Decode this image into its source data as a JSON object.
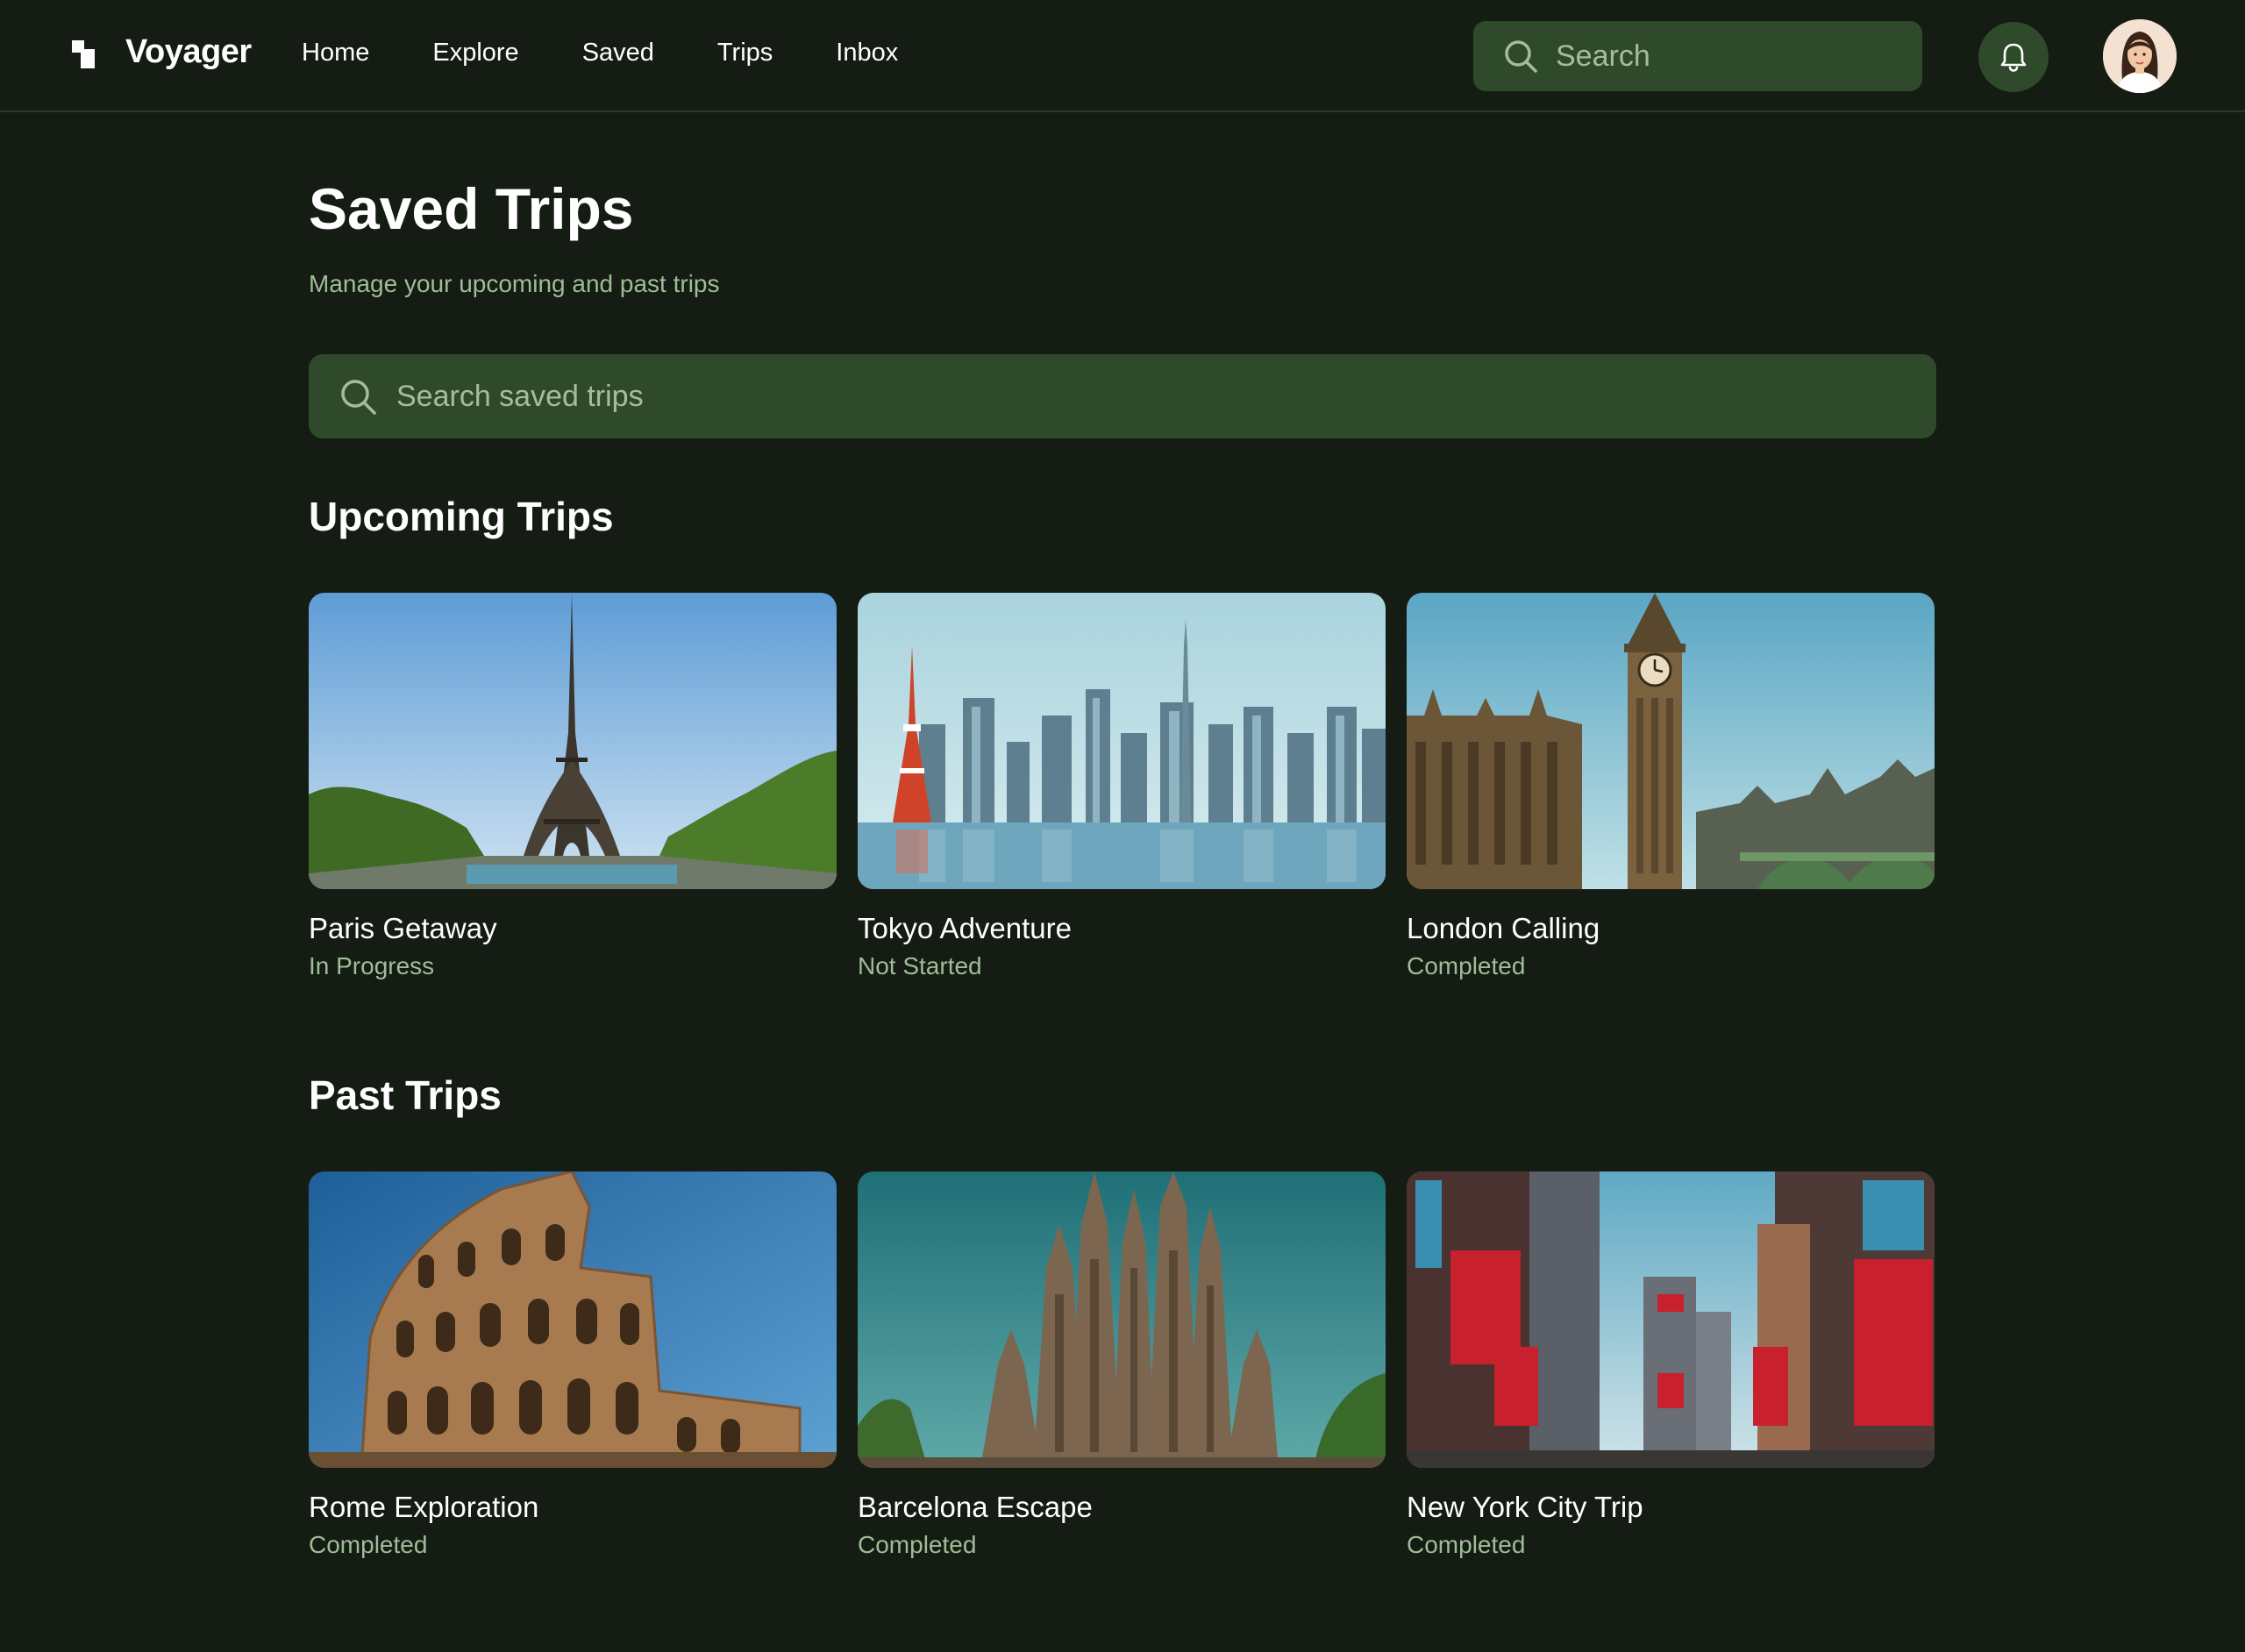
{
  "app": {
    "name": "Voyager"
  },
  "nav": {
    "items": [
      "Home",
      "Explore",
      "Saved",
      "Trips",
      "Inbox"
    ]
  },
  "header": {
    "search_placeholder": "Search"
  },
  "page": {
    "title": "Saved Trips",
    "subtitle": "Manage your upcoming and past trips",
    "search_placeholder": "Search saved trips"
  },
  "sections": [
    {
      "title": "Upcoming Trips",
      "trips": [
        {
          "title": "Paris Getaway",
          "status": "In Progress",
          "image": "eiffel-tower-photo"
        },
        {
          "title": "Tokyo Adventure",
          "status": "Not Started",
          "image": "tokyo-skyline-photo"
        },
        {
          "title": "London Calling",
          "status": "Completed",
          "image": "big-ben-photo"
        }
      ]
    },
    {
      "title": "Past Trips",
      "trips": [
        {
          "title": "Rome Exploration",
          "status": "Completed",
          "image": "colosseum-photo"
        },
        {
          "title": "Barcelona Escape",
          "status": "Completed",
          "image": "sagrada-familia-photo"
        },
        {
          "title": "New York City Trip",
          "status": "Completed",
          "image": "times-square-photo"
        }
      ]
    }
  ],
  "colors": {
    "background": "#141c14",
    "surface": "#2f4a2a",
    "muted_text": "#9fbd96",
    "text": "#ffffff"
  },
  "icons": [
    "voyager-logo-icon",
    "search-icon",
    "bell-icon",
    "user-avatar"
  ]
}
